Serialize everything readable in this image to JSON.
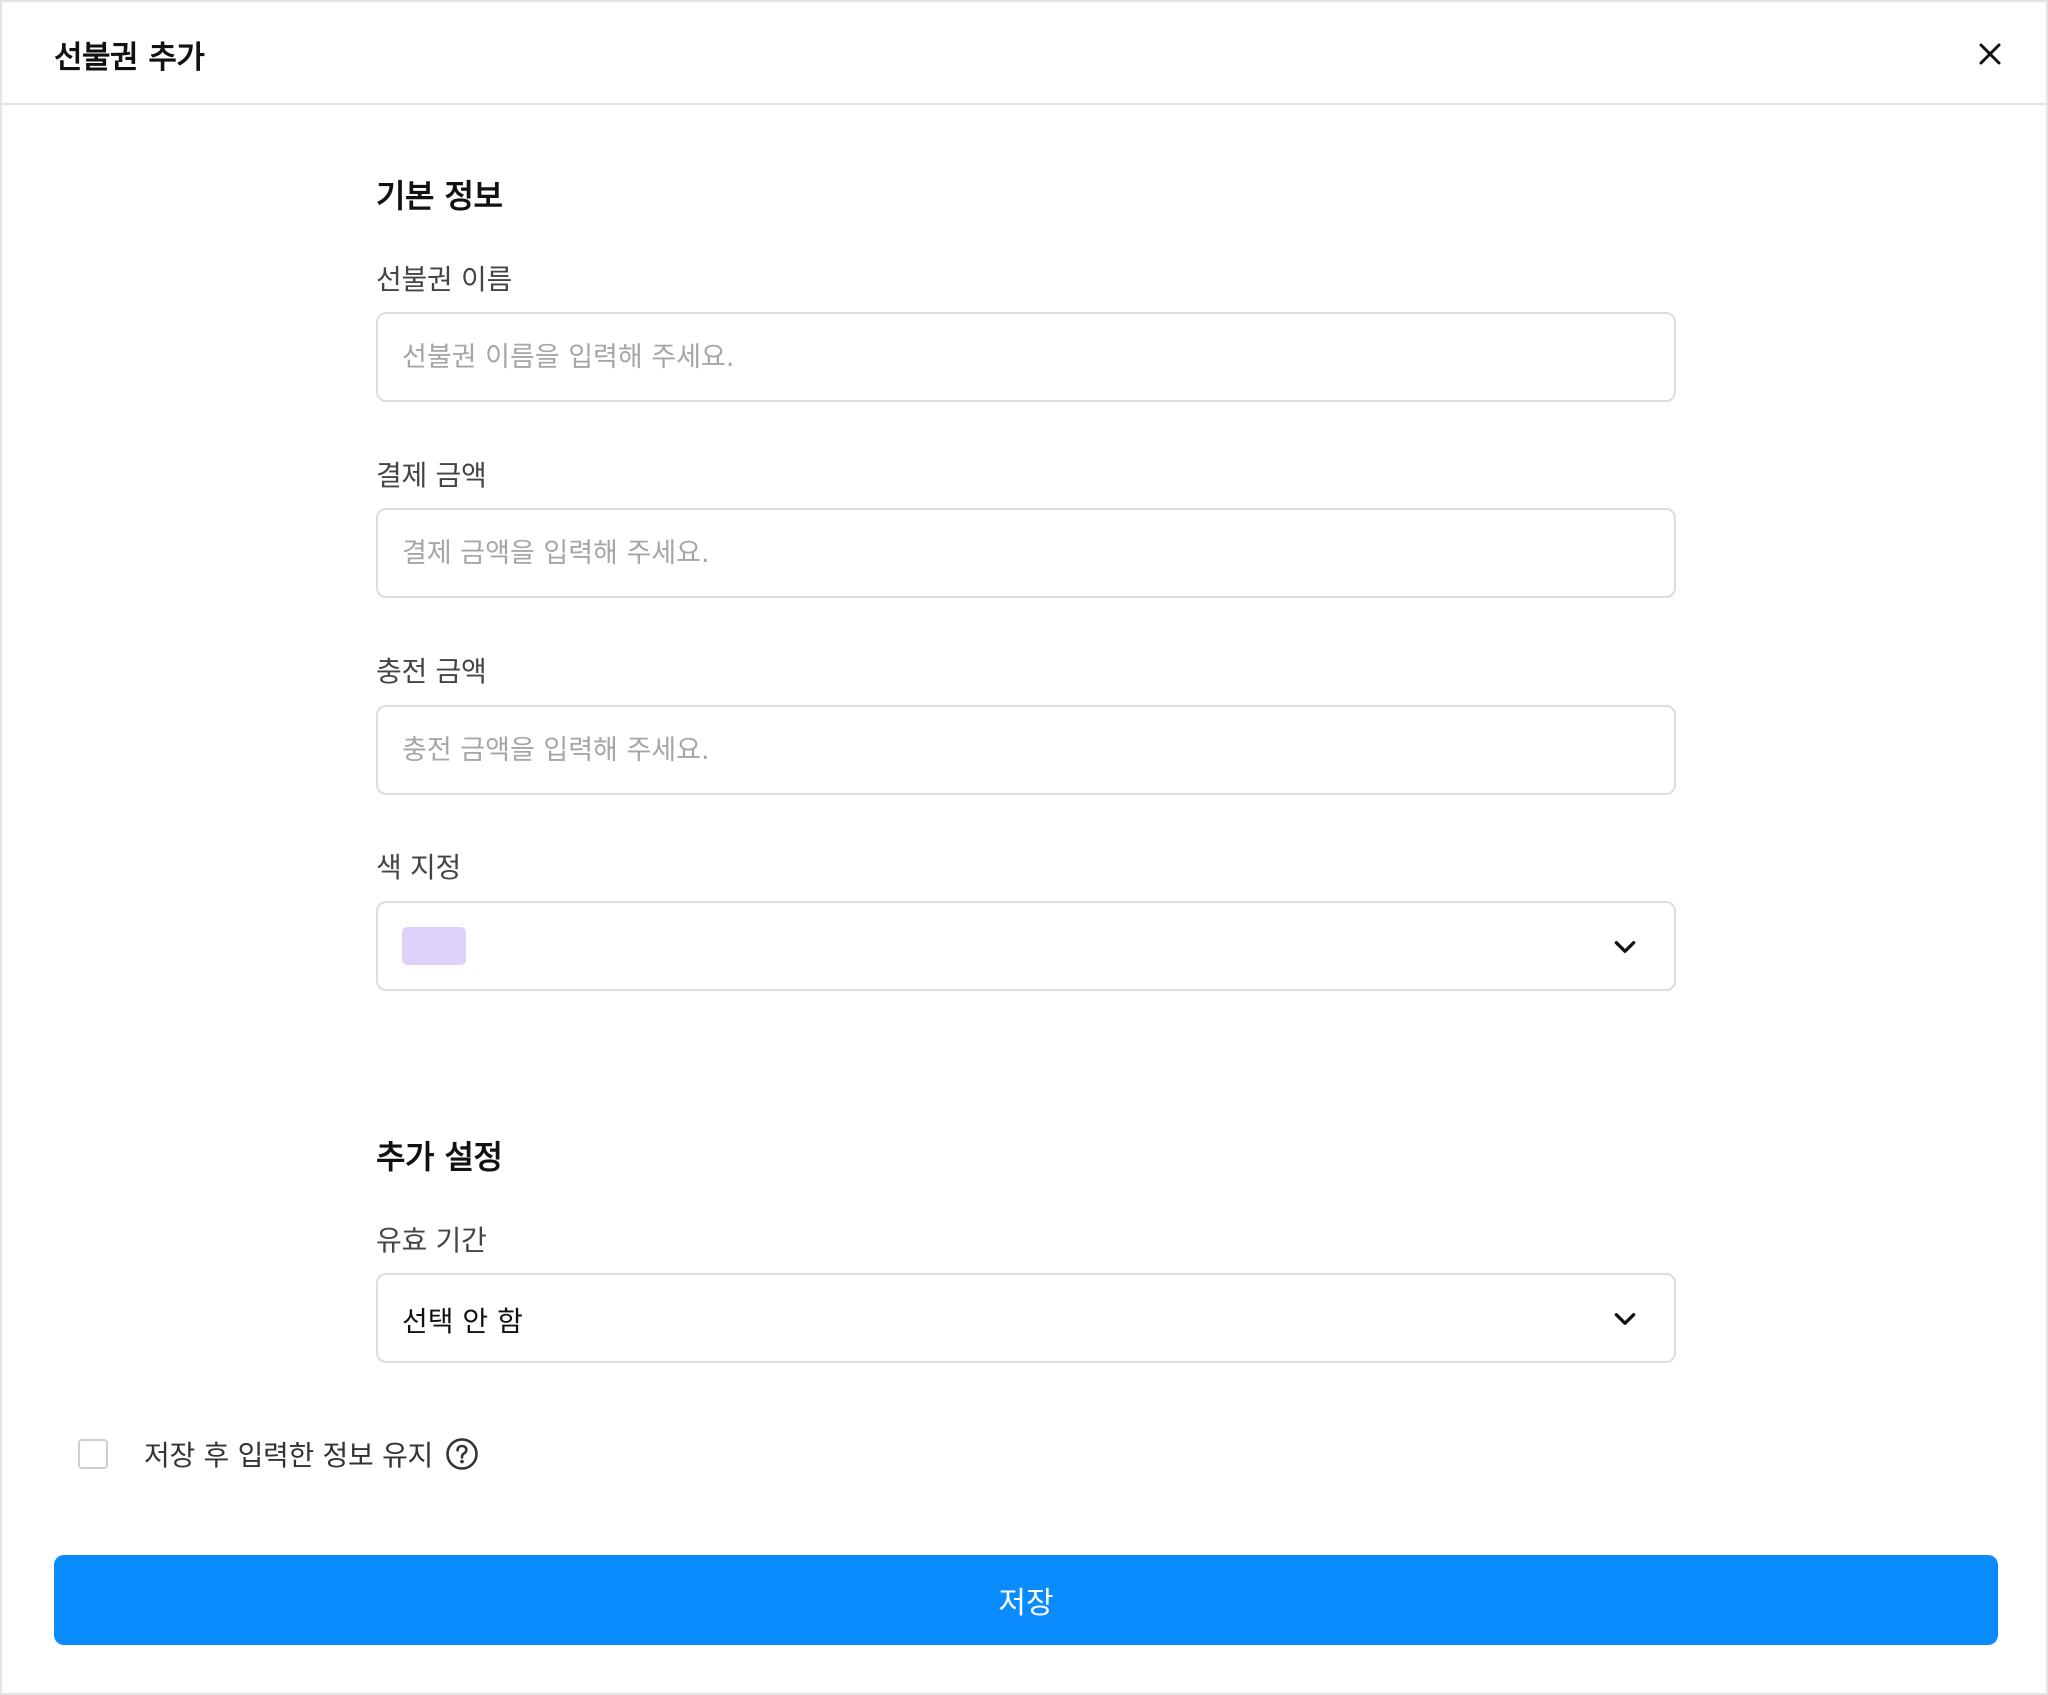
{
  "header": {
    "title": "선불권 추가"
  },
  "basic_info": {
    "section_title": "기본 정보",
    "name_field": {
      "label": "선불권 이름",
      "value": "",
      "placeholder": "선불권 이름을 입력해 주세요."
    },
    "payment_field": {
      "label": "결제 금액",
      "value": "",
      "placeholder": "결제 금액을 입력해 주세요."
    },
    "charge_field": {
      "label": "충전 금액",
      "value": "",
      "placeholder": "충전 금액을 입력해 주세요."
    },
    "color_field": {
      "label": "색 지정",
      "selected_color": "#dcd2fa"
    }
  },
  "additional_settings": {
    "section_title": "추가 설정",
    "validity_field": {
      "label": "유효 기간",
      "selected_value": "선택 안 함"
    }
  },
  "keep_info": {
    "label": "저장 후 입력한 정보 유지",
    "checked": false
  },
  "footer": {
    "save_label": "저장",
    "save_color": "#0a8cff"
  },
  "icons": {
    "close": "close-icon",
    "chevron": "chevron-down-icon",
    "help": "help-icon"
  }
}
